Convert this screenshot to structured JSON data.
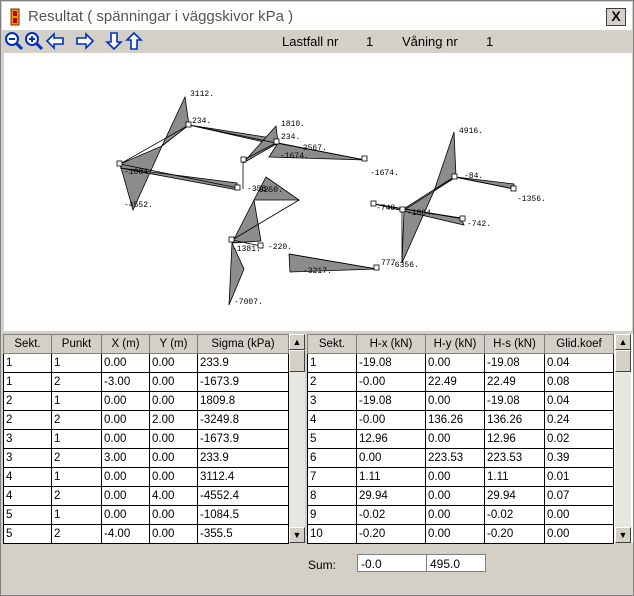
{
  "window": {
    "title": "Resultat ( spänningar i väggskivor kPa )",
    "close_label": "X"
  },
  "toolbar": {
    "icons": [
      "zoom-out-icon",
      "zoom-in-icon",
      "arrow-left-icon",
      "arrow-right-icon",
      "arrow-down-icon",
      "arrow-up-icon"
    ],
    "loadcase_label": "Lastfall nr",
    "loadcase_value": "1",
    "floor_label": "Våning nr",
    "floor_value": "1"
  },
  "plot_labels": [
    "3112.",
    "234.",
    "1810.",
    "234.",
    "-3567.",
    "-1674.",
    "-1674.",
    "-1084.",
    "-4552.",
    "-356.",
    "-3250.",
    "4916.",
    "-84.",
    "-1356.",
    "-748.",
    "-1084.",
    "-742.",
    "-1381.",
    "-220.",
    "-3217.",
    "777",
    "-6356.",
    "-7007."
  ],
  "left_table": {
    "headers": [
      "Sekt.",
      "Punkt",
      "X (m)",
      "Y (m)",
      "Sigma (kPa)"
    ],
    "rows": [
      [
        "1",
        "1",
        "0.00",
        "0.00",
        "233.9"
      ],
      [
        "1",
        "2",
        "-3.00",
        "0.00",
        "-1673.9"
      ],
      [
        "2",
        "1",
        "0.00",
        "0.00",
        "1809.8"
      ],
      [
        "2",
        "2",
        "0.00",
        "2.00",
        "-3249.8"
      ],
      [
        "3",
        "1",
        "0.00",
        "0.00",
        "-1673.9"
      ],
      [
        "3",
        "2",
        "3.00",
        "0.00",
        "233.9"
      ],
      [
        "4",
        "1",
        "0.00",
        "0.00",
        "3112.4"
      ],
      [
        "4",
        "2",
        "0.00",
        "4.00",
        "-4552.4"
      ],
      [
        "5",
        "1",
        "0.00",
        "0.00",
        "-1084.5"
      ],
      [
        "5",
        "2",
        "-4.00",
        "0.00",
        "-355.5"
      ]
    ]
  },
  "right_table": {
    "headers": [
      "Sekt.",
      "H-x (kN)",
      "H-y (kN)",
      "H-s (kN)",
      "Glid.koef"
    ],
    "rows": [
      [
        "1",
        "-19.08",
        "0.00",
        "-19.08",
        "0.04"
      ],
      [
        "2",
        "-0.00",
        "22.49",
        "22.49",
        "0.08"
      ],
      [
        "3",
        "-19.08",
        "0.00",
        "-19.08",
        "0.04"
      ],
      [
        "4",
        "-0.00",
        "136.26",
        "136.26",
        "0.24"
      ],
      [
        "5",
        "12.96",
        "0.00",
        "12.96",
        "0.02"
      ],
      [
        "6",
        "0.00",
        "223.53",
        "223.53",
        "0.39"
      ],
      [
        "7",
        "1.11",
        "0.00",
        "1.11",
        "0.01"
      ],
      [
        "8",
        "29.94",
        "0.00",
        "29.94",
        "0.07"
      ],
      [
        "9",
        "-0.02",
        "0.00",
        "-0.02",
        "0.00"
      ],
      [
        "10",
        "-0.20",
        "0.00",
        "-0.20",
        "0.00"
      ]
    ]
  },
  "sum": {
    "label": "Sum:",
    "hx": "-0.0",
    "hy": "495.0"
  }
}
